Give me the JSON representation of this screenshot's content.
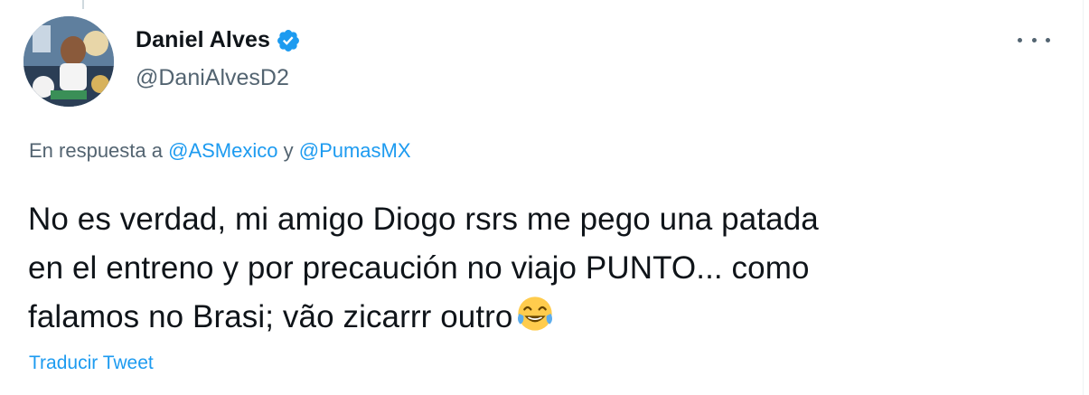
{
  "author": {
    "display_name": "Daniel Alves",
    "handle": "@DaniAlvesD2",
    "verified": true,
    "avatar_icon": "profile-photo"
  },
  "reply": {
    "prefix": "En respuesta a",
    "mention_1": "@ASMexico",
    "conjunction": "y",
    "mention_2": "@PumasMX"
  },
  "tweet": {
    "lines": [
      "No es verdad, mi amigo Diogo rsrs me pego una patada",
      "en el entreno y por precaución no viajo PUNTO... como",
      "falamos no Brasi; vão zicarrr outro"
    ],
    "emoji": "face-with-tears-of-joy"
  },
  "translate_label": "Traducir Tweet",
  "colors": {
    "text": "#0f1419",
    "secondary": "#536471",
    "accent": "#1d9bf0"
  }
}
